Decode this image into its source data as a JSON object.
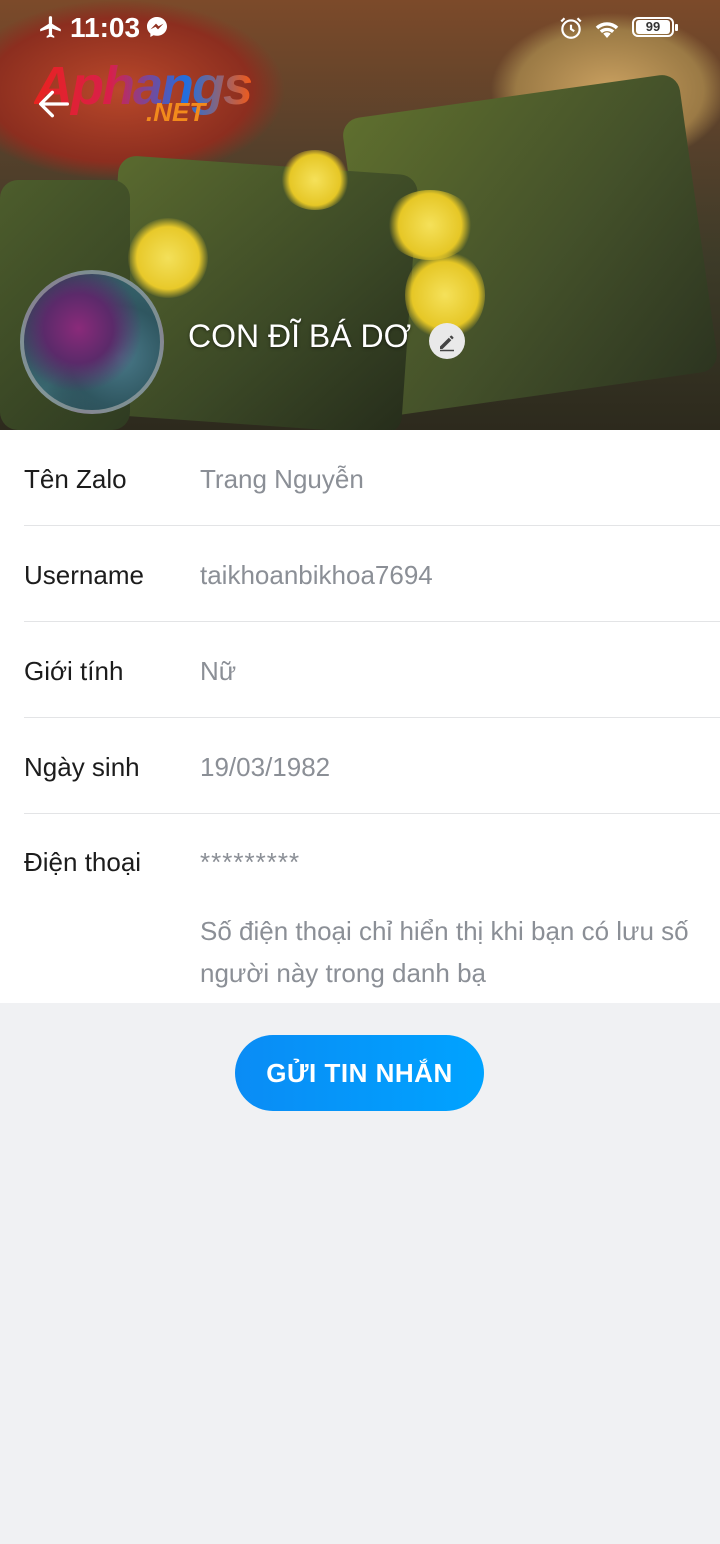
{
  "status_bar": {
    "time": "11:03",
    "battery": "99",
    "icons": [
      "airplane-icon",
      "messenger-icon",
      "alarm-icon",
      "wifi-icon",
      "battery-icon"
    ]
  },
  "watermark": {
    "logo_main": "Aphangs",
    "logo_sub": ".NET"
  },
  "profile": {
    "display_name": "CON ĐĨ BÁ DƠ"
  },
  "fields": [
    {
      "label": "Tên Zalo",
      "value": "Trang Nguyễn"
    },
    {
      "label": "Username",
      "value": "taikhoanbikhoa7694"
    },
    {
      "label": "Giới tính",
      "value": "Nữ"
    },
    {
      "label": "Ngày sinh",
      "value": "19/03/1982"
    }
  ],
  "phone": {
    "label": "Điện thoại",
    "value": "*********",
    "note": "Số điện thoại chỉ hiển thị khi bạn có lưu số người này trong danh bạ"
  },
  "actions": {
    "send_message": "GỬI TIN NHẮN"
  },
  "colors": {
    "accent": "#0a8cf5",
    "label": "#1c1c1c",
    "value": "#8b8f96",
    "background": "#f0f1f3"
  }
}
